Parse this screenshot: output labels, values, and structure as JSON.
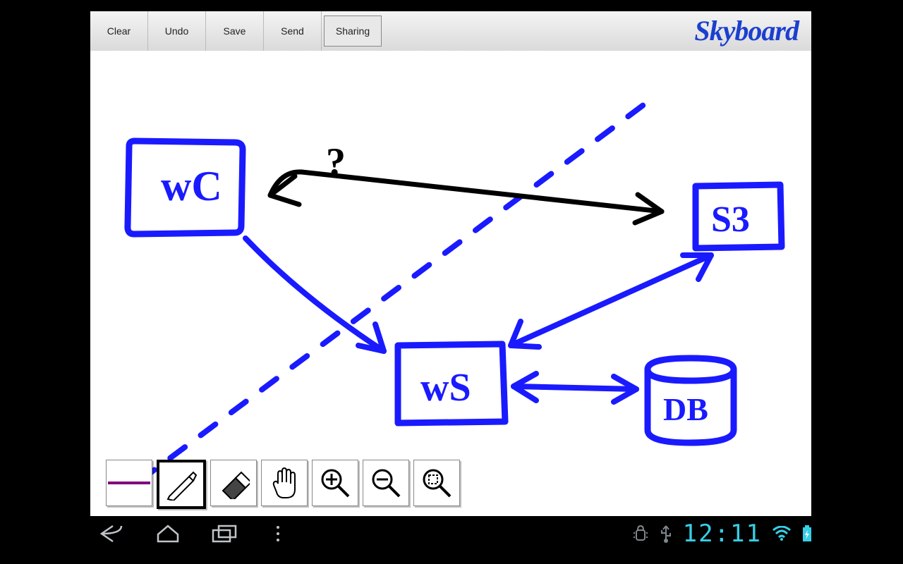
{
  "toolbar": {
    "clear": "Clear",
    "undo": "Undo",
    "save": "Save",
    "send": "Send",
    "sharing": "Sharing"
  },
  "app_name": "Skyboard",
  "tools": {
    "color": "color",
    "pen": "pen",
    "eraser": "eraser",
    "hand": "hand",
    "zoom_in": "zoom-in",
    "zoom_out": "zoom-out",
    "zoom_fit": "zoom-fit",
    "selected": "pen",
    "line_color": "#800080"
  },
  "drawing": {
    "stroke": "#1a1aff",
    "nodes": {
      "wc": "wC",
      "ws": "wS",
      "s3": "S3",
      "db": "DB"
    },
    "question": "?"
  },
  "system": {
    "clock": "12:11"
  }
}
